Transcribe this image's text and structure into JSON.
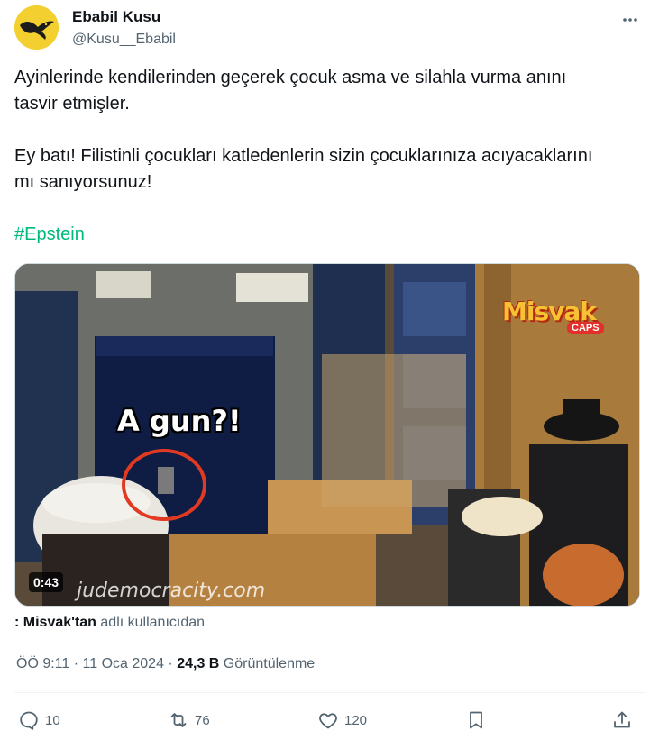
{
  "author": {
    "name": "Ebabil Kusu",
    "handle": "@Kusu__Ebabil"
  },
  "tweet": {
    "line1": "Ayinlerinde kendilerinden geçerek çocuk asma ve silahla vurma anını",
    "line2": "tasvir etmişler.",
    "line3": "Ey batı! Filistinli çocukları katledenlerin sizin çocuklarınıza acıyacaklarını",
    "line4": "mı sanıyorsunuz!",
    "hashtag": "#Epstein"
  },
  "media": {
    "overlay_text": "A gun?!",
    "logo_text": "Misvak",
    "logo_sub": "CAPS",
    "watermark": "judemocracity.com",
    "duration": "0:43"
  },
  "source": {
    "prefix": ": Misvak'tan",
    "suffix": "adlı kullanıcıdan"
  },
  "meta": {
    "time": "ÖÖ 9:11",
    "date": "11 Oca 2024",
    "views_count": "24,3 B",
    "views_label": "Görüntülenme"
  },
  "actions": {
    "reply_count": "10",
    "retweet_count": "76",
    "like_count": "120"
  },
  "colors": {
    "hashtag": "#00ba7c",
    "secondary_text": "#536471",
    "primary_text": "#0f1419"
  }
}
